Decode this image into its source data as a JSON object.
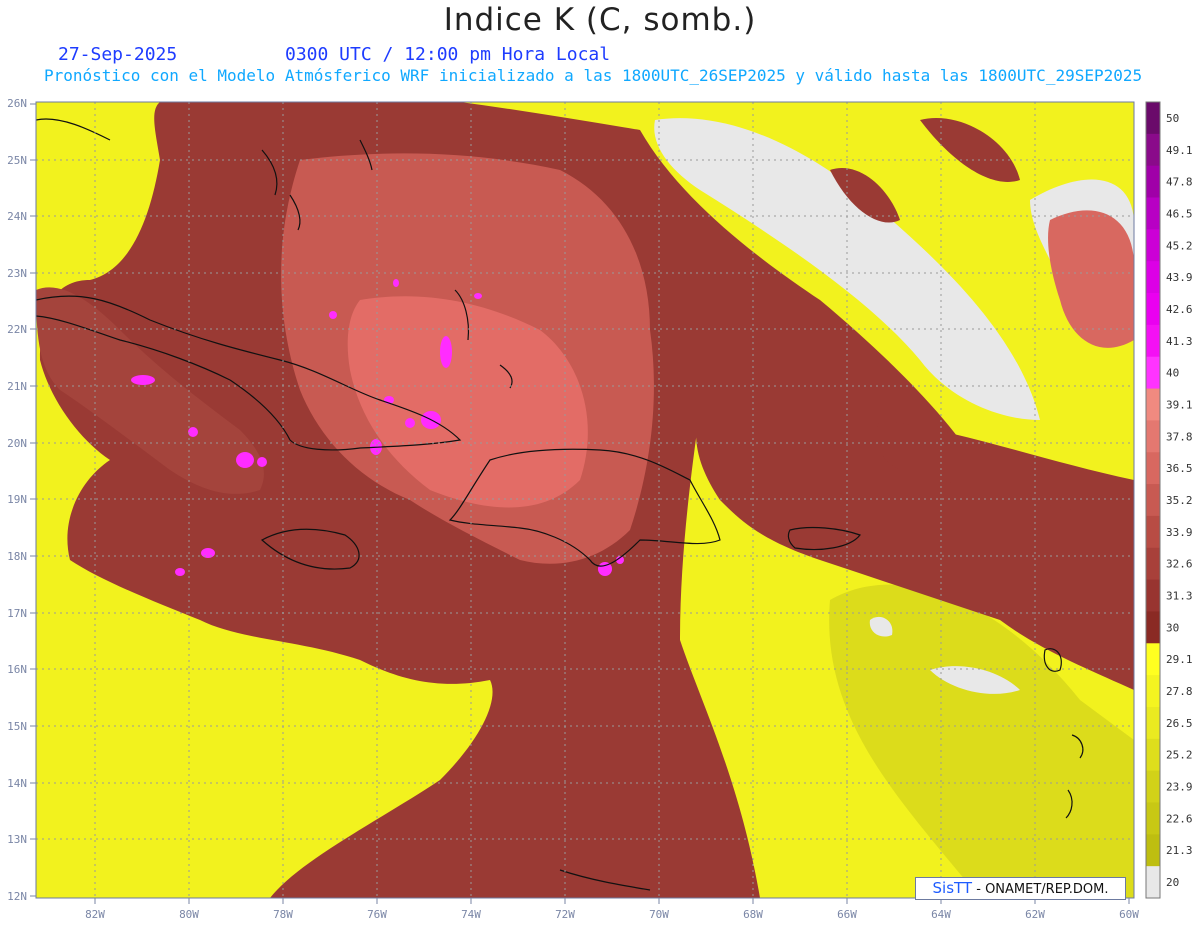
{
  "header": {
    "title": "Indice K (C, somb.)",
    "date": "27-Sep-2025",
    "time": "0300 UTC / 12:00 pm Hora Local",
    "subtitle": "Pronóstico con el Modelo Atmósferico WRF inicializado a las 1800UTC_26SEP2025 y válido hasta las  1800UTC_29SEP2025"
  },
  "axes": {
    "lat_labels": [
      "26N",
      "25N",
      "24N",
      "23N",
      "22N",
      "21N",
      "20N",
      "19N",
      "18N",
      "17N",
      "16N",
      "15N",
      "14N",
      "13N",
      "12N"
    ],
    "lon_labels": [
      "82W",
      "80W",
      "78W",
      "76W",
      "74W",
      "72W",
      "70W",
      "68W",
      "66W",
      "64W",
      "62W",
      "60W"
    ]
  },
  "legend": {
    "labels": [
      "50",
      "49.1",
      "47.8",
      "46.5",
      "45.2",
      "43.9",
      "42.6",
      "41.3",
      "40",
      "39.1",
      "37.8",
      "36.5",
      "35.2",
      "33.9",
      "32.6",
      "31.3",
      "30",
      "29.1",
      "27.8",
      "26.5",
      "25.2",
      "23.9",
      "22.6",
      "21.3",
      "20"
    ],
    "colors": [
      "#6a0a6a",
      "#8a0a8a",
      "#a000a8",
      "#b800c4",
      "#cc00d6",
      "#dc00e6",
      "#ea00f0",
      "#f410f4",
      "#ff33ff",
      "#f08a80",
      "#e47870",
      "#d86860",
      "#c85a52",
      "#b84c44",
      "#a8403a",
      "#983430",
      "#8a2a24",
      "#ffff20",
      "#f4f420",
      "#eaea20",
      "#dede1c",
      "#d2d218",
      "#c8c814",
      "#bebe10",
      "#e8e8e8"
    ]
  },
  "credit": {
    "logo": "SisTT",
    "text": "- ONAMET/REP.DOM."
  },
  "colors": {
    "land_outline": "#111111",
    "grid": "#9a9a9a",
    "low_k": "#f2f21e",
    "high_k": "#9a3a34",
    "very_high_k": "#e8706a",
    "peak_k": "#ff2cff",
    "no_data": "#e8e8e8"
  }
}
